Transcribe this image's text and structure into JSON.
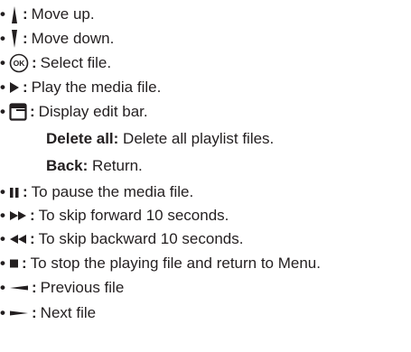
{
  "items": [
    {
      "bullet": "•",
      "icon": "move-up-arrow-icon",
      "colon": ":",
      "text": "Move up."
    },
    {
      "bullet": "•",
      "icon": "move-down-arrow-icon",
      "colon": ":",
      "text": "Move down."
    },
    {
      "bullet": "•",
      "icon": "ok-button-icon",
      "colon": ":",
      "text": "Select file."
    },
    {
      "bullet": "•",
      "icon": "play-icon",
      "colon": ":",
      "text": "Play the media file."
    },
    {
      "bullet": "•",
      "icon": "edit-menu-icon",
      "colon": ":",
      "text": "Display edit bar."
    },
    {
      "bullet": "•",
      "icon": "pause-icon",
      "colon": ":",
      "text": "To pause the media file."
    },
    {
      "bullet": "•",
      "icon": "fast-forward-icon",
      "colon": ":",
      "text": "To skip forward 10 seconds."
    },
    {
      "bullet": "•",
      "icon": "rewind-icon",
      "colon": ":",
      "text": "To skip backward 10 seconds."
    },
    {
      "bullet": "•",
      "icon": "stop-icon",
      "colon": ":",
      "text": "To stop the playing file and return to Menu."
    },
    {
      "bullet": "•",
      "icon": "previous-file-icon",
      "colon": ":",
      "text": "Previous file"
    },
    {
      "bullet": "•",
      "icon": "next-file-icon",
      "colon": ":",
      "text": "Next file"
    }
  ],
  "edit_bar_options": [
    {
      "label": "Delete all:",
      "text": " Delete all playlist files."
    },
    {
      "label": "Back:",
      "text": " Return."
    }
  ]
}
